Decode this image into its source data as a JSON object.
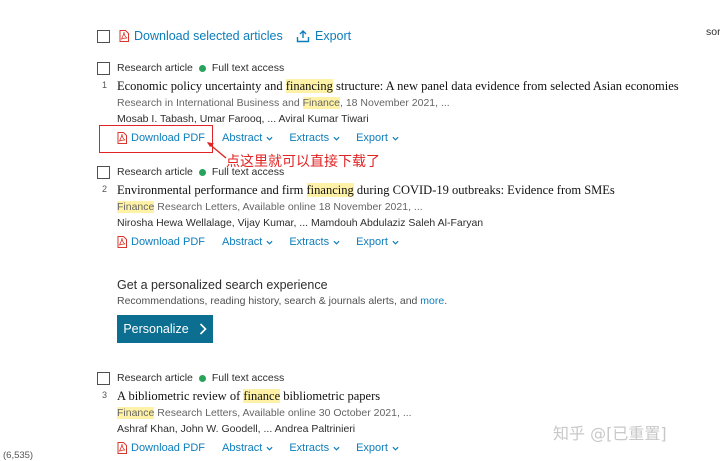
{
  "toolbar": {
    "download_selected": "Download selected articles",
    "export": "Export",
    "sort_cut": "sor"
  },
  "articles": [
    {
      "index": "1",
      "type": "Research article",
      "access": "Full text access",
      "title_parts": [
        "Economic policy uncertainty and ",
        "financing",
        " structure: A new panel data evidence from selected Asian economies"
      ],
      "source_parts": [
        "Research in International Business and ",
        "Finance",
        ", 18 November 2021, ..."
      ],
      "authors": "Mosab I. Tabash, Umar Farooq, ... Aviral Kumar Tiwari",
      "download_pdf": "Download PDF",
      "abstract": "Abstract",
      "extracts": "Extracts",
      "export": "Export"
    },
    {
      "index": "2",
      "type": "Research article",
      "access": "Full text access",
      "title_parts": [
        "Environmental performance and firm ",
        "financing",
        " during COVID-19 outbreaks: Evidence from SMEs"
      ],
      "source_parts": [
        "",
        "Finance",
        " Research Letters, Available online 18 November 2021, ..."
      ],
      "authors": "Nirosha Hewa Wellalage, Vijay Kumar, ... Mamdouh Abdulaziz Saleh Al-Faryan",
      "download_pdf": "Download PDF",
      "abstract": "Abstract",
      "extracts": "Extracts",
      "export": "Export"
    },
    {
      "index": "3",
      "type": "Research article",
      "access": "Full text access",
      "title_parts": [
        "A bibliometric review of ",
        "finance",
        " bibliometric papers"
      ],
      "source_parts": [
        "",
        "Finance",
        " Research Letters, Available online 30 October 2021, ..."
      ],
      "authors": "Ashraf Khan, John W. Goodell, ... Andrea Paltrinieri",
      "download_pdf": "Download PDF",
      "abstract": "Abstract",
      "extracts": "Extracts",
      "export": "Export"
    }
  ],
  "annotation": {
    "text": "点这里就可以直接下载了",
    "color": "#e02424"
  },
  "promo": {
    "title": "Get a personalized search experience",
    "subtitle": "Recommendations, reading history, search & journals alerts, and ",
    "more_link": "more",
    "more_tail": ".",
    "button": "Personalize"
  },
  "footer": {
    "status": "(6,535)"
  },
  "watermark": "知乎 @[已重置]",
  "colors": {
    "link": "#0c7dbb",
    "highlight": "#fff2a6",
    "access_dot": "#29a35a",
    "button": "#0c6f92",
    "pdf_icon": "#d9362b"
  }
}
